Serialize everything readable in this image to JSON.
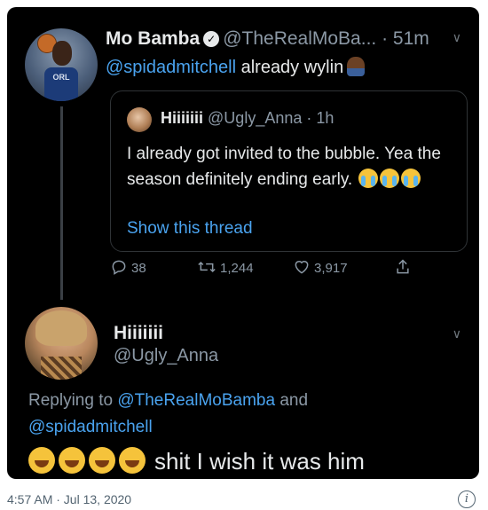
{
  "original_tweet": {
    "display_name": "Mo Bamba",
    "handle": "@TheRealMoBa...",
    "time": "51m",
    "mention": "@spidadmitchell",
    "text": " already wylin",
    "quoted": {
      "display_name": "Hiiiiiii",
      "handle": "@Ugly_Anna",
      "time": "1h",
      "text": "I already got invited to the bubble. Yea the season definitely ending early.",
      "show_thread": "Show this thread"
    },
    "actions": {
      "replies": "38",
      "retweets": "1,244",
      "likes": "3,917"
    }
  },
  "reply_tweet": {
    "display_name": "Hiiiiiii",
    "handle": "@Ugly_Anna",
    "replying_prefix": "Replying to ",
    "replying_to_1": "@TheRealMoBamba",
    "replying_and": " and",
    "replying_to_2": "@spidadmitchell",
    "text": "shit I wish it was him"
  },
  "footer": {
    "timestamp": "4:57 AM · Jul 13, 2020"
  },
  "colors": {
    "background": "#000000",
    "link": "#4aa3ef",
    "muted": "#8b98a5"
  }
}
